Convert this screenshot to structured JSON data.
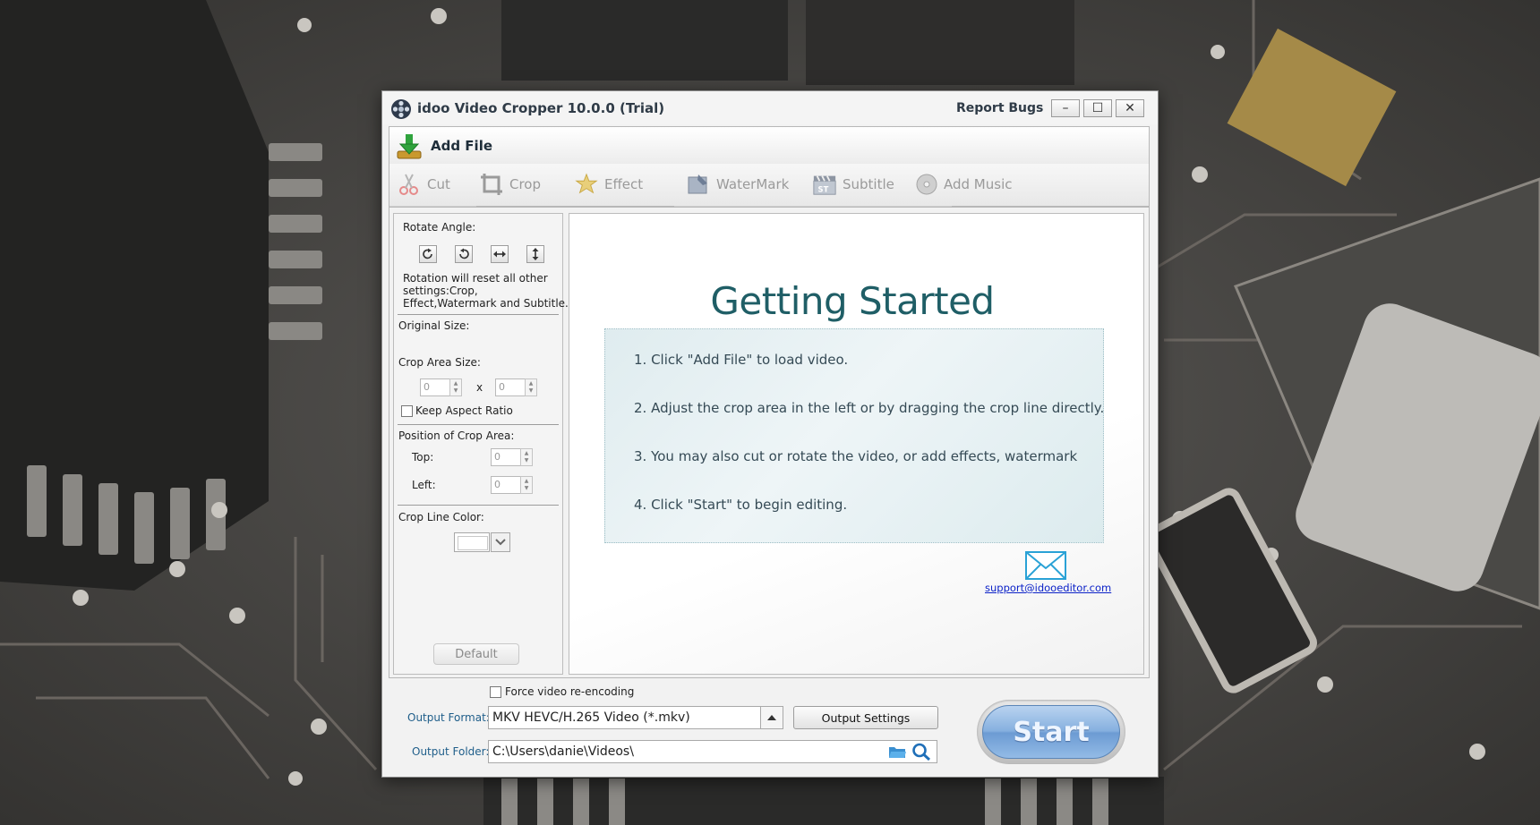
{
  "window": {
    "title": "idoo Video Cropper 10.0.0 (Trial)",
    "report_bugs": "Report Bugs",
    "controls": {
      "minimize": "–",
      "maximize": "☐",
      "close": "✕"
    }
  },
  "toolbar": {
    "add_file": "Add File"
  },
  "tabs": [
    {
      "label": "Cut",
      "icon": "scissors-icon"
    },
    {
      "label": "Crop",
      "icon": "crop-icon"
    },
    {
      "label": "Effect",
      "icon": "effect-star-icon"
    },
    {
      "label": "WaterMark",
      "icon": "watermark-icon"
    },
    {
      "label": "Subtitle",
      "icon": "subtitle-clapper-icon"
    },
    {
      "label": "Add Music",
      "icon": "music-disc-icon"
    }
  ],
  "left_panel": {
    "rotate_angle_label": "Rotate Angle:",
    "rotation_note_1": "Rotation will reset all other",
    "rotation_note_2": "settings:Crop,",
    "rotation_note_3": "Effect,Watermark and Subtitle.",
    "original_size_label": "Original Size:",
    "crop_area_size_label": "Crop Area Size:",
    "crop_width": "0",
    "crop_x_sep": "x",
    "crop_height": "0",
    "keep_aspect_ratio": "Keep Aspect Ratio",
    "keep_aspect_checked": false,
    "position_label": "Position of Crop Area:",
    "top_label": "Top:",
    "top_value": "0",
    "left_label": "Left:",
    "left_value": "0",
    "crop_line_color_label": "Crop Line Color:",
    "crop_line_color": "#ffffff",
    "default_button": "Default"
  },
  "getting_started": {
    "title": "Getting Started",
    "steps": [
      "1. Click \"Add File\" to load video.",
      "2. Adjust the crop area in the left or by dragging the crop line directly.",
      "3. You may also cut or rotate the video, or add effects, watermark",
      "4. Click \"Start\" to begin editing."
    ],
    "support_email": "support@idooeditor.com"
  },
  "output": {
    "force_reencode_label": "Force video re-encoding",
    "force_reencode_checked": false,
    "format_label": "Output Format:",
    "format_value": "MKV HEVC/H.265 Video (*.mkv)",
    "settings_button": "Output Settings",
    "folder_label": "Output Folder:",
    "folder_value": "C:\\Users\\danie\\Videos\\",
    "start_button": "Start"
  },
  "colors": {
    "title_text": "#2f3b47",
    "getting_started_title": "#1f5e66",
    "link": "#0c22c8",
    "start_button": "#7aa6da"
  }
}
